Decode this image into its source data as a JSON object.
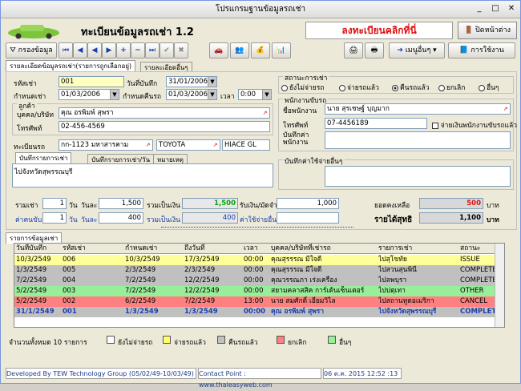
{
  "window": {
    "title": "โปรแกรมฐานข้อมูลรถเช่า"
  },
  "banner": {
    "title": "ทะเบียนข้อมูลรถเช่า 1.2",
    "register_link": "ลงทะเบียนคลิกที่นี่",
    "close_label": "ปิดหน้าต่าง"
  },
  "toolbar": {
    "filter_label": "กรองข้อมูล",
    "menu_label": "เมนูอื่นๆ",
    "usage_label": "การใช้งาน"
  },
  "tabs": {
    "main": "รายละเอียดข้อมูลรถเช่า(รายการถูกเลือกอยู่)",
    "other": "รายละเอียดอื่นๆ"
  },
  "form": {
    "rental_code_label": "รหัสเช่า",
    "rental_code": "001",
    "record_date_label": "วันที่บันทึก",
    "record_date": "31/01/2006",
    "due_date_label": "กำหนดเช่า",
    "due_date": "01/03/2006",
    "return_date_label": "กำหนดคืนรถ",
    "return_date": "01/03/2006",
    "time_label": "เวลา",
    "time": "0:00",
    "customer_group": "ลูกค้า",
    "person_label": "บุคคล/บริษัท",
    "person": "คุณ อรพิมพ์ สุพรา",
    "phone_label": "โทรศัพท์",
    "phone": "02-456-4569",
    "plate_label": "ทะเบียนรถ",
    "plate": "กก-1123 มหาสารคาม",
    "brand": "TOYOTA",
    "model": "HIACE GL"
  },
  "note_tabs": [
    "บันทึกรายการเช่า",
    "บันทึกรายการเช่า/วัน",
    "หมายเหตุ"
  ],
  "note_text": "ไปจังหวัดสุพรรณบุรี",
  "status": {
    "group_label": "สถานะการเช่า",
    "options": [
      "ยังไม่จ่ายรถ",
      "จ่ายรถแล้ว",
      "คืนรถแล้ว",
      "ยกเลิก",
      "อื่นๆ"
    ],
    "selected": "คืนรถแล้ว"
  },
  "staff": {
    "group_label": "พนักงานขับรถ",
    "name_label": "ชื่อพนักงาน",
    "name": "นาย สุรเชษฐ์ บุญมาก",
    "phone_label": "โทรศัพท์",
    "phone": "07-4456189",
    "paid_label": "จ่ายเงินพนักงานขับรถแล้ว",
    "note_label": "บันทึกค่าพนักงาน",
    "other_label": "บันทึกค่าใช้จ่ายอื่นๆ"
  },
  "totals": {
    "rent_label": "รวมเช่า",
    "rent_days": "1",
    "days_unit": "วัน",
    "per_day_label": "วันละ",
    "per_day": "1,500",
    "sum_label": "รวมเป็นเงิน",
    "sum": "1,500",
    "deposit_label": "รับเงิน/มัดจำ",
    "deposit": "1,000",
    "driver_label": "ค่าคนขับ",
    "driver_days": "1",
    "driver_per_day": "400",
    "driver_sum": "400",
    "other_label": "ค่าใช้จ่ายอื่นๆ",
    "other": "",
    "balance_label": "ยอดคงเหลือ",
    "balance": "500",
    "net_label": "รายได้สุทธิ",
    "net": "1,100",
    "unit": "บาท"
  },
  "list": {
    "tab": "รายการข้อมูลเช่า",
    "headers": [
      "วันที่บันทึก",
      "รหัสเช่า",
      "กำหนดเช่า",
      "ถึงวันที่",
      "เวลา",
      "บุคคล/บริษัทที่เช่ารถ",
      "รายการเช่า",
      "สถานะ"
    ],
    "rows": [
      {
        "c": [
          "10/3/2549",
          "006",
          "10/3/2549",
          "17/3/2549",
          "00:00",
          "คุณสุรรรณ มีใจดี",
          "ไปสุโขทัย",
          "ISSUE"
        ],
        "bg": "#ffff99"
      },
      {
        "c": [
          "1/3/2549",
          "005",
          "2/3/2549",
          "2/3/2549",
          "00:00",
          "คุณสุรรรณ มีใจดี",
          "ไปสวนสุนพินี",
          "COMPLETE"
        ],
        "bg": "#c0c0c0"
      },
      {
        "c": [
          "7/2/2549",
          "004",
          "7/2/2549",
          "12/2/2549",
          "00:00",
          "คุณวรรณภา เร่งเครื่อง",
          "ไปลพบุรา",
          "COMPLETE"
        ],
        "bg": "#c0c0c0"
      },
      {
        "c": [
          "5/2/2549",
          "003",
          "7/2/2549",
          "12/2/2549",
          "00:00",
          "สยามคลาสสิค การ์เด้นเซ็นเตอร์",
          "ไปปตฺเทา",
          "OTHER"
        ],
        "bg": "#99ee99"
      },
      {
        "c": [
          "5/2/2549",
          "002",
          "6/2/2549",
          "7/2/2549",
          "13:00",
          "นาย สมศักดิ์ เอี่ยมวิไล",
          "ไปสถานทูตอเมริกา",
          "CANCEL"
        ],
        "bg": "#ff8080"
      },
      {
        "c": [
          "31/1/2549",
          "001",
          "1/3/2549",
          "1/3/2549",
          "00:00",
          "คุณ อรพิมพ์ สุพรา",
          "ไปจังหวัดสุพรรณบุรี",
          "COMPLET"
        ],
        "bg": "#c0c0c0",
        "sel": true
      }
    ]
  },
  "legend": {
    "count": "จำนวนทั้งหมด 10 รายการ",
    "items": [
      {
        "label": "ยังไม่จ่ายรถ",
        "color": "#ffffff"
      },
      {
        "label": "จ่ายรถแล้ว",
        "color": "#ffff66"
      },
      {
        "label": "คืนรถแล้ว",
        "color": "#c0c0c0"
      },
      {
        "label": "ยกเลิก",
        "color": "#ff8080"
      },
      {
        "label": "อื่นๆ",
        "color": "#99ee99"
      }
    ]
  },
  "statusbar": {
    "dev": "Developed By TEW Technology Group (05/02/49-10/03/49)",
    "contact": "Contact Point : www.thaieasyweb.com",
    "datetime": "06 ต.ค. 2015 12:52 :13"
  }
}
